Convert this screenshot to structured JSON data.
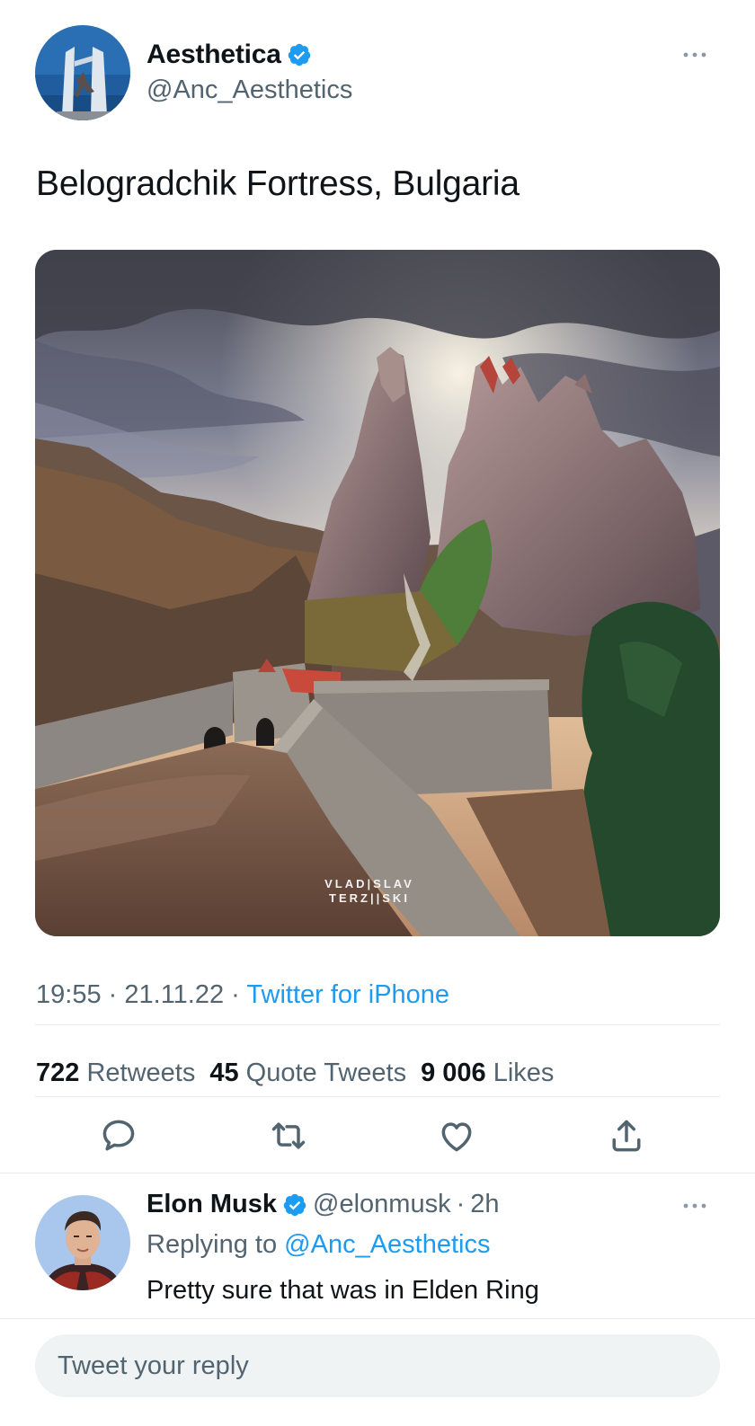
{
  "tweet": {
    "author": {
      "display_name": "Aesthetica",
      "handle": "@Anc_Aesthetics",
      "verified": true
    },
    "text": "Belogradchik Fortress, Bulgaria",
    "photo": {
      "watermark_line1": "VLAD|SLAV",
      "watermark_line2": "TERZ||SKI"
    },
    "time": "19:55",
    "date": "21.11.22",
    "source": "Twitter for iPhone",
    "separator": "·",
    "stats": {
      "retweets_count": "722",
      "retweets_label": "Retweets",
      "quotes_count": "45",
      "quotes_label": "Quote Tweets",
      "likes_count": "9 006",
      "likes_label": "Likes"
    }
  },
  "reply": {
    "display_name": "Elon Musk",
    "handle": "@elonmusk",
    "time": "2h",
    "replying_prefix": "Replying to",
    "replying_to": "@Anc_Aesthetics",
    "text": "Pretty sure that was in Elden Ring"
  },
  "composer": {
    "placeholder": "Tweet your reply"
  },
  "icons": [
    "more-icon",
    "verified-icon",
    "reply-icon",
    "retweet-icon",
    "like-icon",
    "share-icon"
  ],
  "colors": {
    "accent": "#1d9bf0",
    "secondary_text": "#536471",
    "primary_text": "#0f1419",
    "divider": "#e7e9ec",
    "composer_bg": "#eff3f4"
  }
}
